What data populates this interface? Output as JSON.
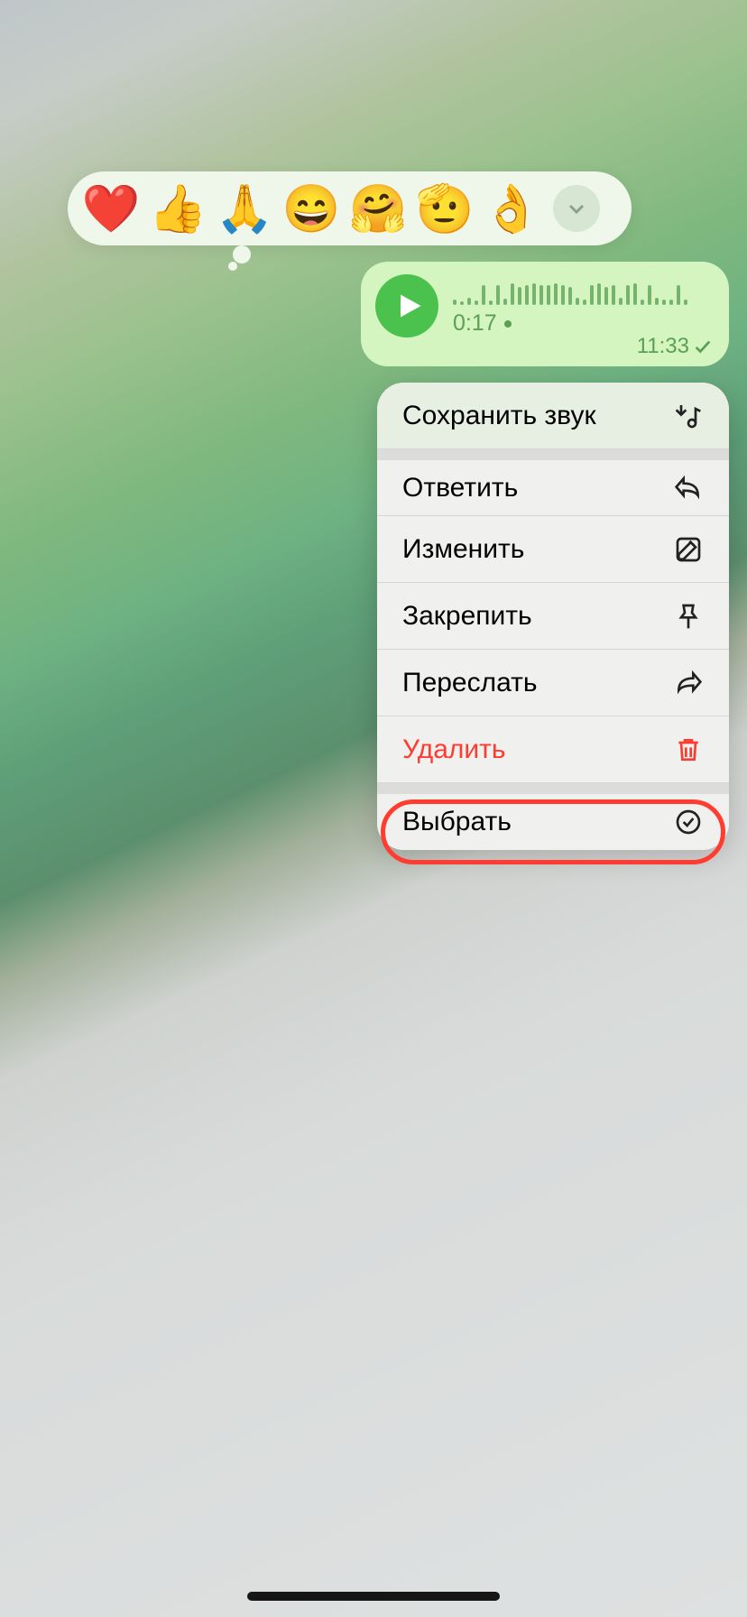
{
  "reactions": {
    "items": [
      "❤️",
      "👍",
      "🙏",
      "😄",
      "🤗",
      "🫡",
      "👌"
    ]
  },
  "voice": {
    "duration": "0:17",
    "timestamp": "11:33",
    "waveform": [
      6,
      4,
      8,
      5,
      22,
      5,
      22,
      7,
      24,
      20,
      22,
      24,
      22,
      22,
      24,
      22,
      20,
      8,
      6,
      22,
      24,
      20,
      22,
      8,
      22,
      24,
      6,
      22,
      8,
      6,
      6,
      22,
      6
    ]
  },
  "menu": {
    "save_sound": "Сохранить звук",
    "reply": "Ответить",
    "edit": "Изменить",
    "pin": "Закрепить",
    "forward": "Переслать",
    "delete": "Удалить",
    "select": "Выбрать"
  }
}
